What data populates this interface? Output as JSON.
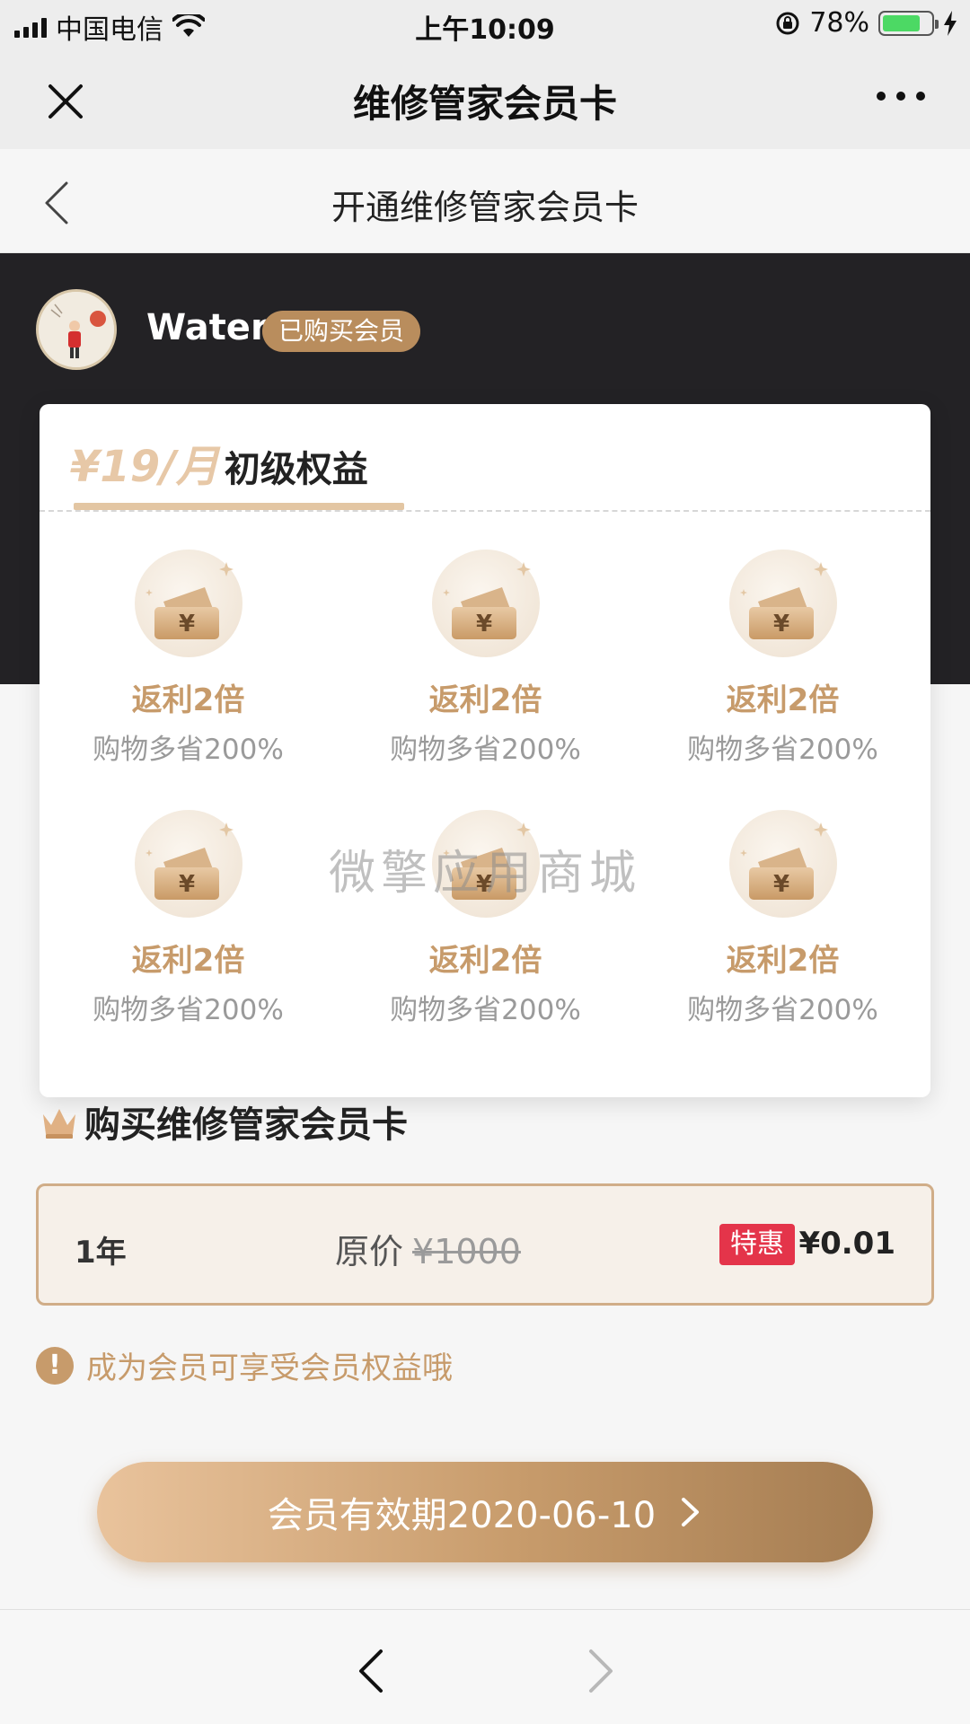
{
  "status_bar": {
    "carrier": "中国电信",
    "time": "上午10:09",
    "battery_percent": "78%",
    "battery_level": 0.78
  },
  "wechat_nav": {
    "title": "维修管家会员卡"
  },
  "page": {
    "title": "开通维修管家会员卡"
  },
  "user": {
    "name": "Water",
    "badge": "已购买会员"
  },
  "tier": {
    "price": "¥19/月",
    "name": "初级权益"
  },
  "benefits": [
    {
      "title": "返利2倍",
      "desc": "购物多省200%",
      "icon": "coupon-ticket-icon"
    },
    {
      "title": "返利2倍",
      "desc": "购物多省200%",
      "icon": "coupon-ticket-icon"
    },
    {
      "title": "返利2倍",
      "desc": "购物多省200%",
      "icon": "coupon-ticket-icon"
    },
    {
      "title": "返利2倍",
      "desc": "购物多省200%",
      "icon": "coupon-ticket-icon"
    },
    {
      "title": "返利2倍",
      "desc": "购物多省200%",
      "icon": "coupon-ticket-icon"
    },
    {
      "title": "返利2倍",
      "desc": "购物多省200%",
      "icon": "coupon-ticket-icon"
    }
  ],
  "watermark": "微擎应用商城",
  "purchase": {
    "title": "购买维修管家会员卡",
    "plan": {
      "period": "1年",
      "original_label": "原价",
      "original_price": "¥1000",
      "promo_badge": "特惠",
      "price": "¥0.01"
    },
    "notice": "成为会员可享受会员权益哦",
    "notice_icon_glyph": "!"
  },
  "validity_button": {
    "label": "会员有效期2020-06-10"
  },
  "colors": {
    "accent_gold": "#c79b6b",
    "dark_banner": "#232225",
    "promo_red": "#e4344a"
  }
}
